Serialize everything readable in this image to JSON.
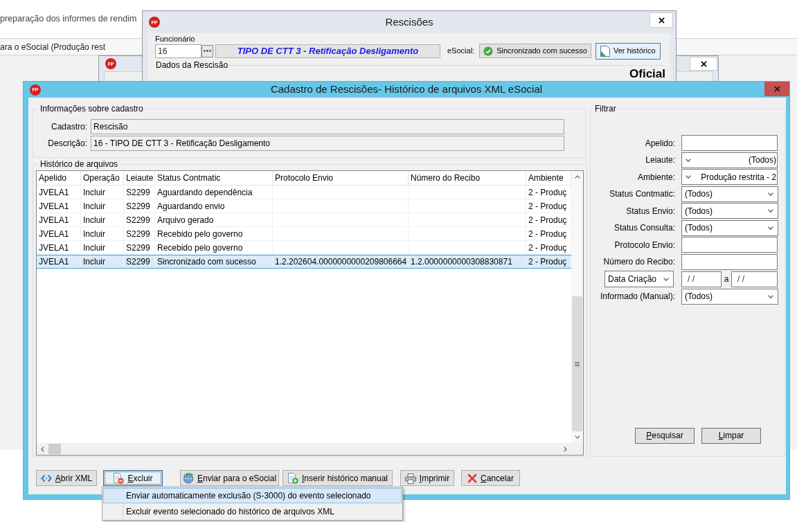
{
  "background_app": {
    "heading": "preparação dos informes de rendim",
    "tab": "ara o eSocial (Produção rest"
  },
  "employee_window": {
    "logo": "FP",
    "title": "Rescisões",
    "employee_label": "Funcionário",
    "employee_code": "16",
    "employee_name": "TIPO DE CTT 3 - Retificação Desligamento",
    "esocial_label": "eSocial:",
    "status_button": "Sincronizado com sucesso",
    "history_button": "Ver histórico",
    "section_title": "Dados da Rescisão",
    "badge": "Oficial"
  },
  "parent_window": {
    "logo": "FP"
  },
  "history_window": {
    "logo": "FP",
    "title": "Cadastro de Rescisões- Histórico de arquivos XML eSocial",
    "info_group": {
      "title": "Informações sobre cadastro",
      "fields": [
        {
          "label": "Cadastro:",
          "value": "Rescisão"
        },
        {
          "label": "Descrição:",
          "value": "16 - TIPO DE CTT 3 - Retificação Desligamento"
        }
      ]
    },
    "history_group": {
      "title": "Histórico de arquivos",
      "table": {
        "columns": [
          "Apelido",
          "Operação",
          "Leiaute",
          "Status Contmatic",
          "Protocolo Envio",
          "Número do Recibo",
          "Ambiente"
        ],
        "rows": [
          {
            "selected": false,
            "cells": [
              "JVELA1",
              "Incluir",
              "S2299",
              "Aguardando dependência",
              null,
              null,
              "2 - Produç"
            ]
          },
          {
            "selected": false,
            "cells": [
              "JVELA1",
              "Incluir",
              "S2299",
              "Aguardando envio",
              null,
              null,
              "2 - Produç"
            ]
          },
          {
            "selected": false,
            "cells": [
              "JVELA1",
              "Incluir",
              "S2299",
              "Arquivo gerado",
              null,
              null,
              "2 - Produç"
            ]
          },
          {
            "selected": false,
            "cells": [
              "JVELA1",
              "Incluir",
              "S2299",
              "Recebido pelo governo",
              null,
              null,
              "2 - Produç"
            ]
          },
          {
            "selected": false,
            "cells": [
              "JVELA1",
              "Incluir",
              "S2299",
              "Recebido pelo governo",
              null,
              null,
              "2 - Produç"
            ]
          },
          {
            "selected": true,
            "cells": [
              "JVELA1",
              "Incluir",
              "S2299",
              "Sincronizado com sucesso",
              "1.2.202604.0000000000209806664",
              "1.2.0000000000308830871",
              "2 - Produç"
            ]
          }
        ]
      }
    },
    "filter_group": {
      "title": "Filtrar",
      "fields": [
        {
          "kind": "input",
          "label": "Apelido:"
        },
        {
          "kind": "select_reversed",
          "label": "Leiaute:",
          "value": "(Todos)"
        },
        {
          "kind": "select_reversed",
          "label": "Ambiente:",
          "value": "Produção restrita - 2"
        },
        {
          "kind": "select",
          "label": "Status Contmatic:",
          "value": "(Todos)"
        },
        {
          "kind": "select",
          "label": "Status Envio:",
          "value": "(Todos)"
        },
        {
          "kind": "select",
          "label": "Status Consulta:",
          "value": "(Todos)"
        },
        {
          "kind": "input",
          "label": "Protocolo Envio:"
        },
        {
          "kind": "input",
          "label": "Número do Recibo:"
        },
        {
          "kind": "date_range",
          "selector": "Data Criação",
          "from": "/ /",
          "separator": "a",
          "to": "/ /"
        },
        {
          "kind": "select",
          "label": "Informado (Manual):",
          "value": "(Todos)"
        }
      ],
      "buttons": [
        {
          "label": "Pesquisar",
          "mnemonic": true
        },
        {
          "label": "Limpar",
          "mnemonic": true
        }
      ]
    },
    "buttons": [
      {
        "kind": "open_xml",
        "label": "Abrir XML",
        "mnemonic": true,
        "pressed": false
      },
      {
        "kind": "delete",
        "label": "Excluir",
        "mnemonic": true,
        "pressed": true
      },
      {
        "kind": "send",
        "label": "Enviar para o eSocial",
        "mnemonic": true,
        "pressed": false
      },
      {
        "kind": "insert",
        "label": "Inserir histórico manual",
        "mnemonic": true,
        "pressed": false
      },
      {
        "kind": "print",
        "label": "Imprimir",
        "mnemonic": true,
        "pressed": false
      },
      {
        "kind": "cancel",
        "label": "Cancelar",
        "mnemonic": true,
        "pressed": false
      }
    ],
    "menu": {
      "items": [
        {
          "label": "Enviar automaticamente exclusão (S-3000) do evento selecionado",
          "selected": true
        },
        {
          "label": "Excluir evento selecionado do histórico de arquivos XML",
          "selected": false
        }
      ]
    }
  }
}
